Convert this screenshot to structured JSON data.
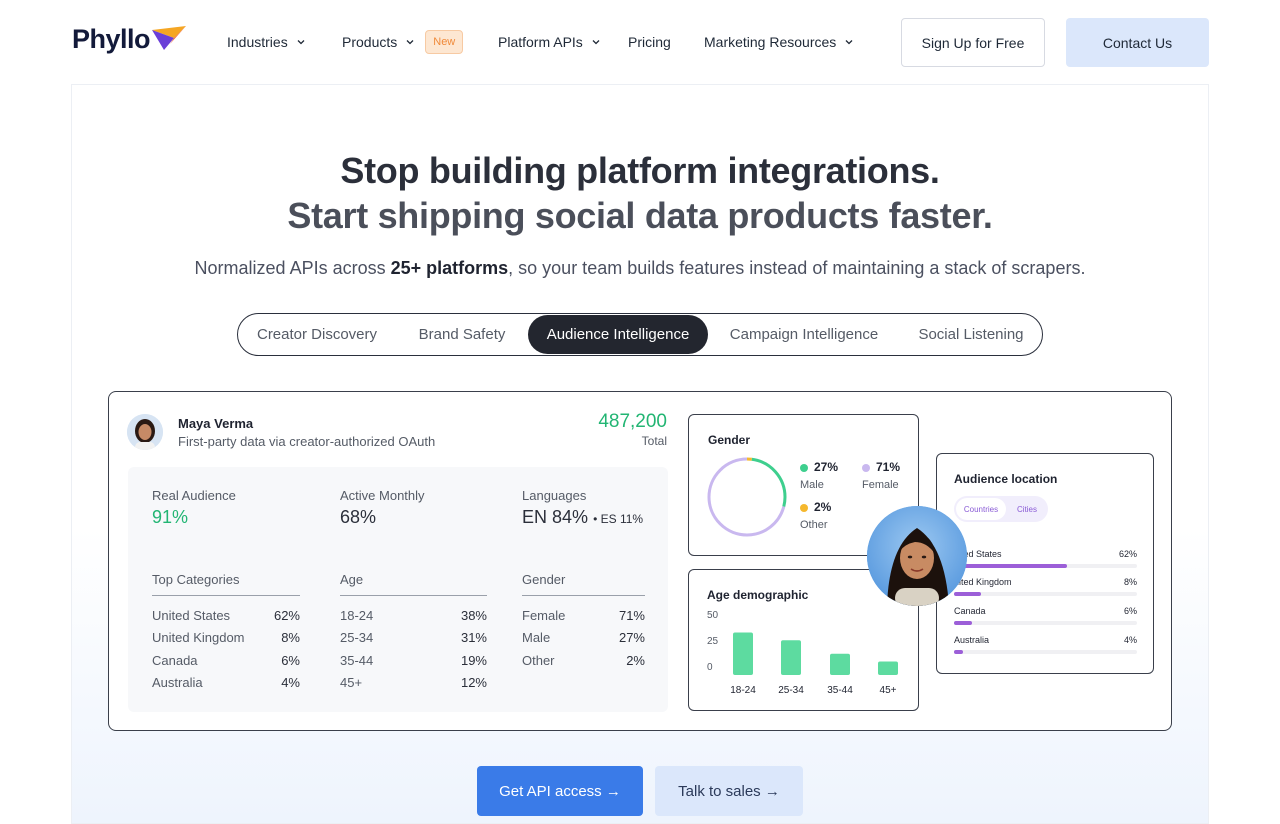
{
  "nav": {
    "logo_text": "Phyllo",
    "items": [
      {
        "label": "Industries"
      },
      {
        "label": "Products",
        "badge": "New"
      },
      {
        "label": "Platform APIs"
      },
      {
        "label": "Pricing"
      },
      {
        "label": "Marketing Resources"
      }
    ],
    "signup_label": "Sign Up for Free",
    "contact_label": "Contact Us"
  },
  "hero": {
    "title_line1": "Stop building platform integrations.",
    "title_line2": "Start shipping social data products faster.",
    "subtitle_pre": "Normalized APIs across ",
    "subtitle_bold": "25+ platforms",
    "subtitle_post": ", so your team builds features instead of maintaining a stack of scrapers."
  },
  "tabs": [
    {
      "label": "Creator Discovery"
    },
    {
      "label": "Brand Safety"
    },
    {
      "label": "Audience Intelligence",
      "active": true
    },
    {
      "label": "Campaign Intelligence"
    },
    {
      "label": "Social Listening"
    }
  ],
  "profile": {
    "name": "Maya Verma",
    "description": "First-party data via creator-authorized OAuth",
    "total_value": "487,200",
    "total_label": "Total"
  },
  "stats": {
    "real_audience_label": "Real Audience",
    "real_audience_value": "91%",
    "active_monthly_label": "Active Monthly",
    "active_monthly_value": "68%",
    "languages_label": "Languages",
    "languages_value": "EN 84%",
    "languages_secondary": "• ES 11%",
    "columns": [
      {
        "header": "Top Categories",
        "rows": [
          [
            "United States",
            "62%"
          ],
          [
            "United Kingdom",
            "8%"
          ],
          [
            "Canada",
            "6%"
          ],
          [
            "Australia",
            "4%"
          ]
        ]
      },
      {
        "header": "Age",
        "rows": [
          [
            "18-24",
            "38%"
          ],
          [
            "25-34",
            "31%"
          ],
          [
            "35-44",
            "19%"
          ],
          [
            "45+",
            "12%"
          ]
        ]
      },
      {
        "header": "Gender",
        "rows": [
          [
            "Female",
            "71%"
          ],
          [
            "Male",
            "27%"
          ],
          [
            "Other",
            "2%"
          ]
        ]
      }
    ]
  },
  "gender_widget": {
    "title": "Gender",
    "male": {
      "value": "27%",
      "label": "Male",
      "fraction": 0.27,
      "color": "#3ecf8e"
    },
    "female": {
      "value": "71%",
      "label": "Female",
      "fraction": 0.71,
      "color": "#c9b8ef"
    },
    "other": {
      "value": "2%",
      "label": "Other",
      "fraction": 0.02,
      "color": "#f5b82e"
    }
  },
  "age_widget": {
    "title": "Age demographic",
    "bar_color": "#5ddba0"
  },
  "location_widget": {
    "title": "Audience location",
    "toggle": [
      "Countries",
      "Cities"
    ],
    "bar_color": "#9c5fd8",
    "rows": [
      {
        "label": "nited States",
        "value": "62%",
        "fraction": 0.62
      },
      {
        "label": "nited Kingdom",
        "value": "8%",
        "fraction": 0.15
      },
      {
        "label": "Canada",
        "value": "6%",
        "fraction": 0.1
      },
      {
        "label": "Australia",
        "value": "4%",
        "fraction": 0.05
      }
    ]
  },
  "chart_data": {
    "type": "bar",
    "title": "Age demographic",
    "categories": [
      "18-24",
      "25-34",
      "35-44",
      "45+"
    ],
    "values": [
      38,
      31,
      19,
      12
    ],
    "yticks": [
      "50",
      "25",
      "0"
    ],
    "ylim": [
      0,
      50
    ]
  },
  "cta": {
    "primary": "Get API access →",
    "secondary": "Talk to sales →"
  }
}
